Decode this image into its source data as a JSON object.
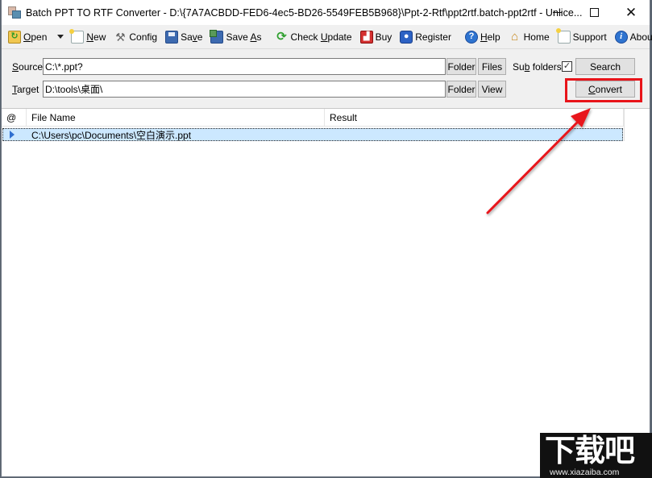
{
  "window": {
    "title": "Batch PPT TO RTF Converter - D:\\{7A7ACBDD-FED6-4ec5-BD26-5549FEB5B968}\\Ppt-2-Rtf\\ppt2rtf.batch-ppt2rtf - Unlice...",
    "controls": {
      "minimize": "minimize",
      "maximize": "maximize",
      "close": "✕"
    }
  },
  "toolbar": {
    "items": [
      {
        "id": "open",
        "pre": "",
        "u": "O",
        "post": "pen",
        "icon": "open-folder-icon"
      },
      {
        "id": "new",
        "pre": "",
        "u": "N",
        "post": "ew",
        "icon": "new-document-icon"
      },
      {
        "id": "config",
        "pre": "Config",
        "u": "",
        "post": "",
        "icon": "tools-icon"
      },
      {
        "id": "save",
        "pre": "Sa",
        "u": "v",
        "post": "e",
        "icon": "save-icon"
      },
      {
        "id": "saveas",
        "pre": "Save ",
        "u": "A",
        "post": "s",
        "icon": "save-as-icon"
      },
      {
        "id": "checkupdate",
        "pre": "Check ",
        "u": "U",
        "post": "pdate",
        "icon": "refresh-icon"
      },
      {
        "id": "buy",
        "pre": "Buy",
        "u": "",
        "post": "",
        "icon": "cart-icon"
      },
      {
        "id": "register",
        "pre": "Register",
        "u": "",
        "post": "",
        "icon": "user-icon"
      },
      {
        "id": "help",
        "pre": "",
        "u": "H",
        "post": "elp",
        "icon": "help-icon"
      },
      {
        "id": "home",
        "pre": "Home",
        "u": "",
        "post": "",
        "icon": "home-icon"
      },
      {
        "id": "support",
        "pre": "Support",
        "u": "",
        "post": "",
        "icon": "support-icon"
      },
      {
        "id": "about",
        "pre": "About",
        "u": "",
        "post": "",
        "icon": "info-icon"
      }
    ],
    "icon_glyphs": {
      "open": "↻",
      "config": "⚒",
      "update": "⟳",
      "buy": "🛒",
      "register": "👤",
      "help": "?",
      "home": "⌂",
      "about": "i"
    }
  },
  "form": {
    "source": {
      "label_u": "S",
      "label_rest": "ource",
      "value": "C:\\*.ppt?"
    },
    "target": {
      "label_u": "T",
      "label_rest": "arget",
      "value": "D:\\tools\\桌面\\"
    },
    "buttons": {
      "source_folder": "Folder",
      "source_files": "Files",
      "target_folder": "Folder",
      "target_view": "View",
      "search": "Search",
      "convert_u": "C",
      "convert_rest": "onvert"
    },
    "subfolders": {
      "pre": "Su",
      "u": "b",
      "post": " folders",
      "checked": true,
      "check_glyph": "✓"
    }
  },
  "grid": {
    "columns": [
      "@",
      "File Name",
      "Result"
    ],
    "rows": [
      {
        "file": "C:\\Users\\pc\\Documents\\空白演示.ppt",
        "result": ""
      }
    ]
  },
  "annotation": {
    "color": "#e8141a"
  },
  "watermark": {
    "main": "下载吧",
    "url": "www.xiazaiba.com"
  }
}
